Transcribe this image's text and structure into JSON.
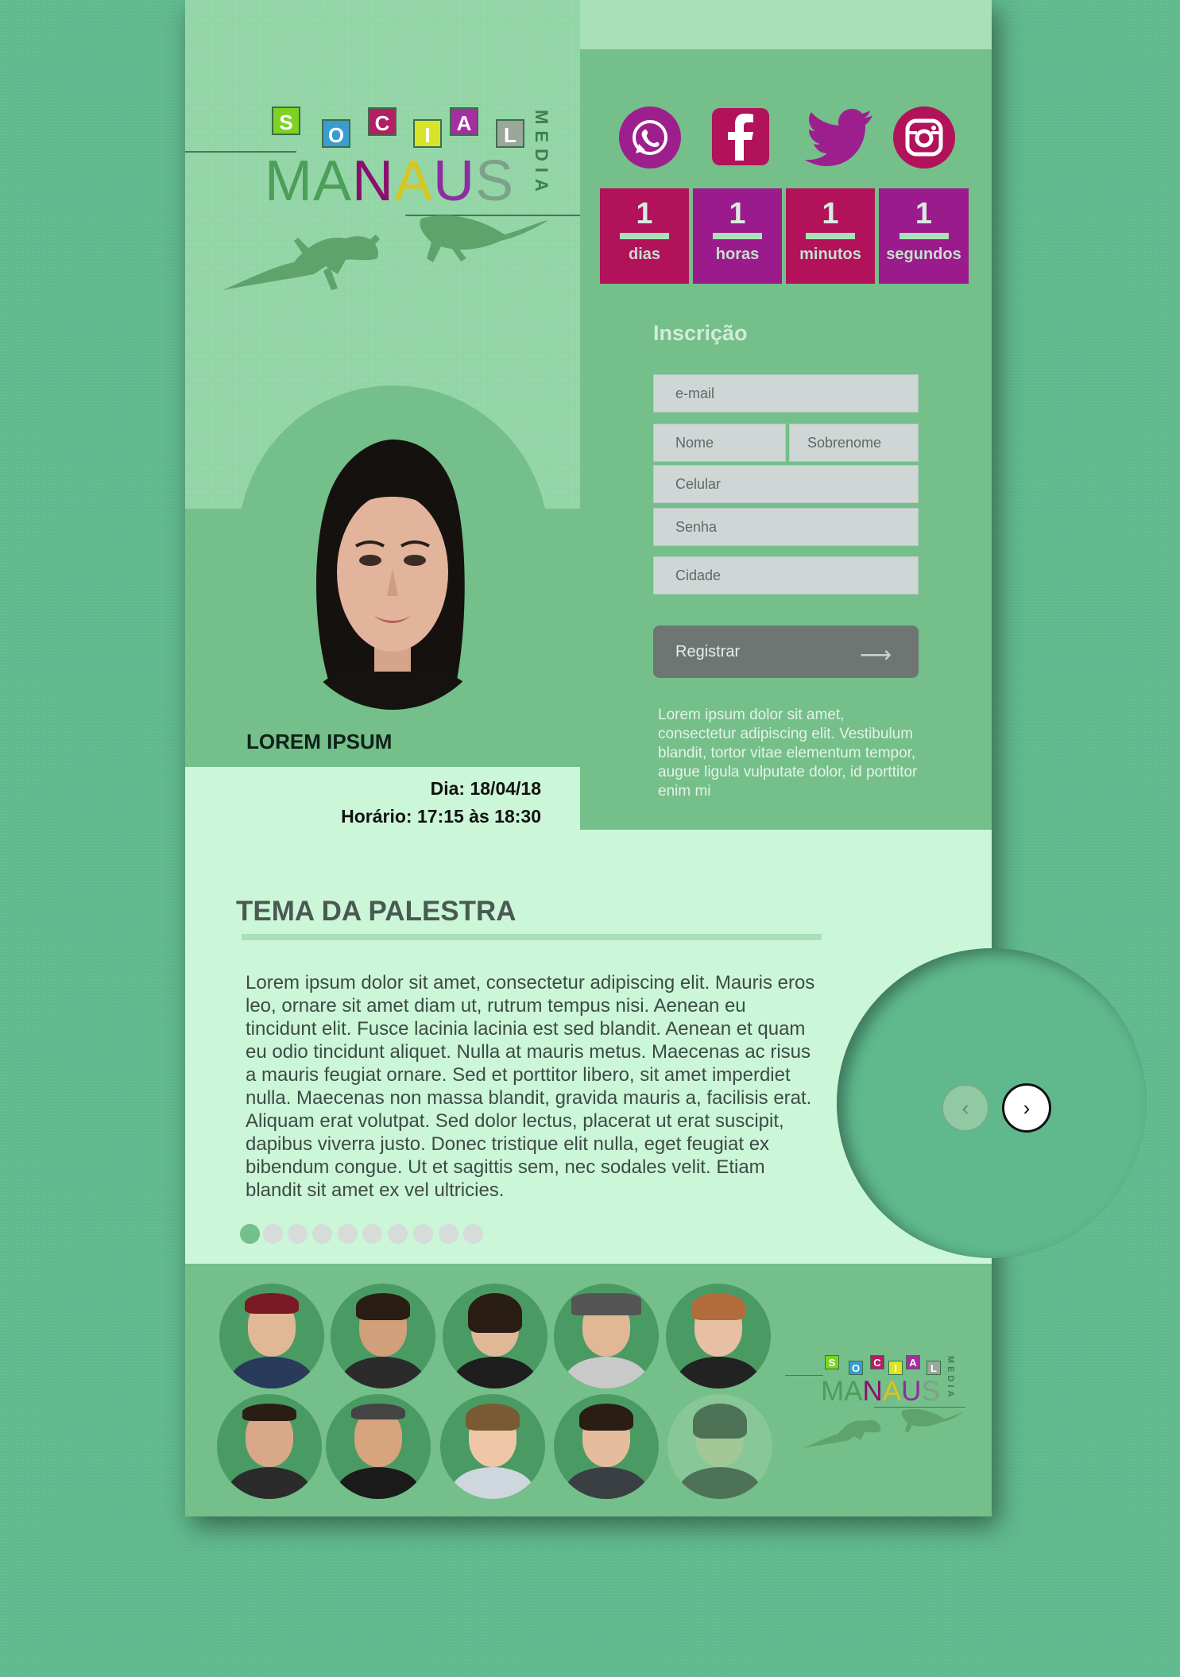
{
  "logo": {
    "letters": [
      "S",
      "O",
      "C",
      "I",
      "A",
      "L"
    ],
    "letter_colors": [
      "#7cd321",
      "#3a9ccf",
      "#b21f62",
      "#d8e32a",
      "#a42fa1",
      "#9aa79a"
    ],
    "word_letters": [
      "M",
      "A",
      "N",
      "A",
      "U",
      "S"
    ],
    "word_colors": [
      "#4b9f59",
      "#4b9f59",
      "#8a0f6e",
      "#d8c61f",
      "#8d2ea0",
      "#7da18a"
    ],
    "side": "MEDIA"
  },
  "social": [
    {
      "name": "whatsapp-icon",
      "color": "#9d1f8e"
    },
    {
      "name": "facebook-icon",
      "color": "#b1125a"
    },
    {
      "name": "twitter-icon",
      "color": "#9d1f8e"
    },
    {
      "name": "instagram-icon",
      "color": "#b1125a"
    }
  ],
  "countdown": [
    {
      "value": "1",
      "label": "dias",
      "color": "#b1125a"
    },
    {
      "value": "1",
      "label": "horas",
      "color": "#9b1b8c"
    },
    {
      "value": "1",
      "label": "minutos",
      "color": "#b1125a"
    },
    {
      "value": "1",
      "label": "segundos",
      "color": "#9b1b8c"
    }
  ],
  "form": {
    "title": "Inscrição",
    "email": "e-mail",
    "nome": "Nome",
    "sobrenome": "Sobrenome",
    "celular": "Celular",
    "senha": "Senha",
    "cidade": "Cidade",
    "submit": "Registrar",
    "submit_icon": "arrow-right-icon"
  },
  "side_text": "Lorem ipsum dolor sit amet, consectetur adipiscing elit. Vestibulum blandit, tortor vitae elementum tempor, augue ligula vulputate dolor, id porttitor enim mi",
  "speaker": {
    "name": "LOREM IPSUM",
    "date": "Dia: 18/04/18",
    "time": "Horário: 17:15 às 18:30"
  },
  "topic": {
    "title": "TEMA DA PALESTRA",
    "body": "Lorem ipsum dolor sit amet, consectetur adipiscing elit. Mauris eros leo, ornare sit amet diam ut, rutrum tempus nisi. Aenean eu tincidunt elit. Fusce lacinia lacinia est sed blandit. Aenean et quam eu odio tincidunt aliquet. Nulla at mauris metus. Maecenas ac risus a mauris feugiat ornare. Sed et porttitor libero, sit amet imperdiet nulla. Maecenas non massa blandit, gravida mauris a, facilisis erat. Aliquam erat volutpat. Sed dolor lectus, placerat ut erat suscipit, dapibus viverra justo. Donec tristique elit nulla, eget feugiat ex bibendum congue. Ut et sagittis sem, nec sodales velit. Etiam blandit sit amet ex vel ultricies.",
    "pages": 10,
    "active_page": 1,
    "prev_icon": "chevron-left-icon",
    "next_icon": "chevron-right-icon"
  },
  "colors": {
    "page_bg": "#5fb98d",
    "panel": "#74bf8a",
    "light": "#ccf6d8",
    "accent_magenta": "#b1125a",
    "accent_purple": "#9b1b8c"
  }
}
